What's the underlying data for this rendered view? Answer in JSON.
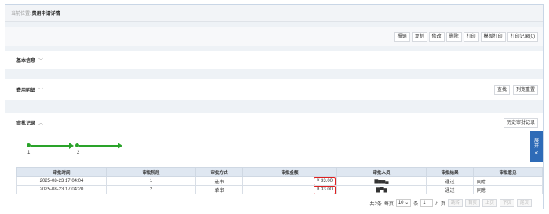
{
  "breadcrumb": {
    "label": "当前位置:",
    "title": "费用申请详情"
  },
  "toolbar": {
    "buttons": [
      "报销",
      "复制",
      "修改",
      "删除",
      "打印",
      "模板打印",
      "打印记录(0)"
    ]
  },
  "sections": {
    "basic": {
      "title": "基本信息"
    },
    "details": {
      "title": "费用明细",
      "buttons": [
        "查找",
        "列宽重置"
      ]
    },
    "approval": {
      "title": "审批记录",
      "history_button": "历史审批记录"
    }
  },
  "side_tab": {
    "line1": "展",
    "line2": "开",
    "icon": "«"
  },
  "flow": {
    "steps": [
      "1",
      "2"
    ],
    "completed_count": 2
  },
  "table": {
    "headers": [
      "审批时间",
      "审批阶段",
      "审批方式",
      "审批金额",
      "审批人员",
      "审批结果",
      "审批意见"
    ],
    "rows": [
      {
        "time": "2025-08-23 17:04:04",
        "stage": "1",
        "method": "选审",
        "amount": "¥ 33.00",
        "person": "▇▆▅▄",
        "result": "通过",
        "opinion": "同意"
      },
      {
        "time": "2025-08-23 17:04:20",
        "stage": "2",
        "method": "单审",
        "amount": "¥ 33.00",
        "person": "▇▀▆",
        "result": "通过",
        "opinion": "同意"
      }
    ]
  },
  "pager": {
    "total": "共2条",
    "per_page_label": "每页",
    "per_page": "10",
    "unit": "条",
    "page": "1",
    "page_total": "/1 页",
    "buttons": [
      "跳转",
      "首页",
      "上页",
      "下页",
      "尾页"
    ]
  },
  "colors": {
    "accent": "#2e6bb7",
    "flow_green": "#2aa32a",
    "highlight_red": "#e02020"
  }
}
